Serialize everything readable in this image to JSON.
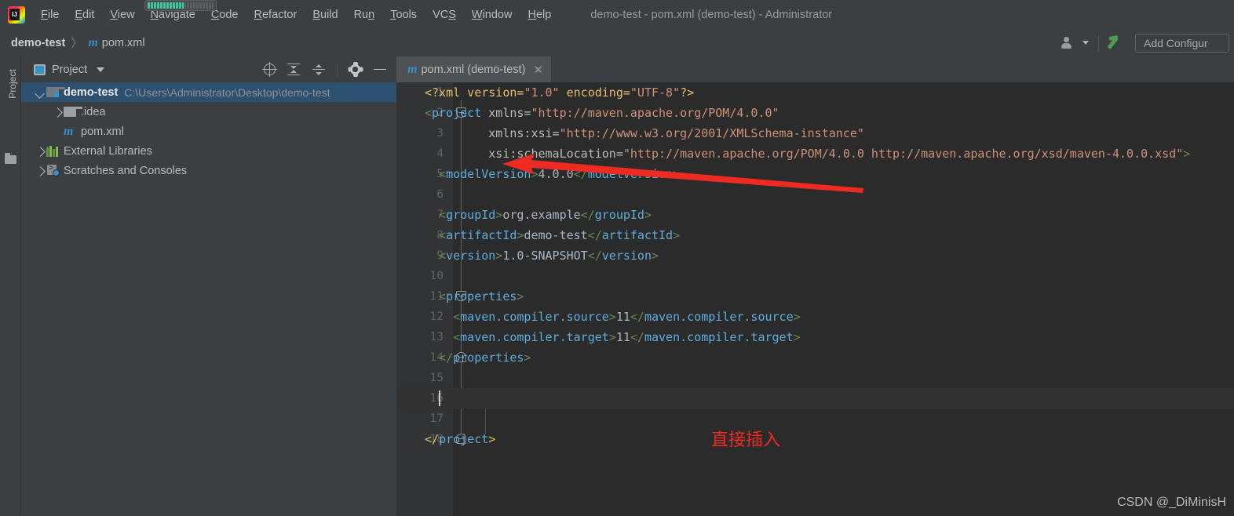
{
  "window": {
    "title": "demo-test - pom.xml (demo-test) - Administrator",
    "logo_icon": "intellij-idea-logo"
  },
  "menubar": {
    "items": [
      {
        "label": "File",
        "mnemonic": "F"
      },
      {
        "label": "Edit",
        "mnemonic": "E"
      },
      {
        "label": "View",
        "mnemonic": "V"
      },
      {
        "label": "Navigate",
        "mnemonic": "N"
      },
      {
        "label": "Code",
        "mnemonic": "C"
      },
      {
        "label": "Refactor",
        "mnemonic": "R"
      },
      {
        "label": "Build",
        "mnemonic": "B"
      },
      {
        "label": "Run",
        "mnemonic": "n"
      },
      {
        "label": "Tools",
        "mnemonic": "T"
      },
      {
        "label": "VCS",
        "mnemonic": "S"
      },
      {
        "label": "Window",
        "mnemonic": "W"
      },
      {
        "label": "Help",
        "mnemonic": "H"
      }
    ]
  },
  "navbar": {
    "breadcrumb_project": "demo-test",
    "breadcrumb_sep": "〉",
    "breadcrumb_file": "pom.xml",
    "maven_icon": "m",
    "user_icon": "user-account-icon",
    "build_icon": "build-hammer-icon",
    "add_configuration": "Add Configur"
  },
  "left_strip": {
    "project_tool_label": "Project",
    "folder_icon": "folder-icon"
  },
  "project_panel": {
    "title": "Project",
    "toolbar_icons": [
      {
        "name": "select-opened-file-icon"
      },
      {
        "name": "expand-all-icon"
      },
      {
        "name": "collapse-all-icon"
      },
      {
        "name": "settings-gear-icon"
      },
      {
        "name": "hide-panel-icon"
      }
    ],
    "tree": [
      {
        "label": "demo-test",
        "path": "C:\\Users\\Administrator\\Desktop\\demo-test",
        "icon": "project-module-icon",
        "arrow": "down",
        "indent": 0,
        "selected": true,
        "bold": true
      },
      {
        "label": ".idea",
        "path": "",
        "icon": "folder-icon",
        "arrow": "right",
        "indent": 1,
        "selected": false,
        "bold": false
      },
      {
        "label": "pom.xml",
        "path": "",
        "icon": "maven-file-icon",
        "arrow": "none",
        "indent": 1,
        "selected": false,
        "bold": false
      },
      {
        "label": "External Libraries",
        "path": "",
        "icon": "libraries-icon",
        "arrow": "right",
        "indent": 0,
        "selected": false,
        "bold": false
      },
      {
        "label": "Scratches and Consoles",
        "path": "",
        "icon": "scratches-icon",
        "arrow": "right",
        "indent": 0,
        "selected": false,
        "bold": false
      }
    ]
  },
  "editor": {
    "tab_label": "pom.xml (demo-test)",
    "tab_icon": "maven-file-icon",
    "tab_close_icon": "close-icon",
    "cursor_line": 16,
    "line_numbers": [
      1,
      2,
      3,
      4,
      5,
      6,
      7,
      8,
      9,
      10,
      11,
      12,
      13,
      14,
      15,
      16,
      17,
      18
    ],
    "code_lines": [
      {
        "n": 1,
        "tokens": [
          {
            "t": "<?xml version=",
            "c": "s-proc"
          },
          {
            "t": "\"1.0\"",
            "c": "s-val"
          },
          {
            "t": " encoding=",
            "c": "s-proc"
          },
          {
            "t": "\"UTF-8\"",
            "c": "s-val"
          },
          {
            "t": "?>",
            "c": "s-proc"
          }
        ],
        "indent": 0
      },
      {
        "n": 2,
        "tokens": [
          {
            "t": "<",
            "c": "s-brk"
          },
          {
            "t": "project",
            "c": "s-name"
          },
          {
            "t": " xmlns=",
            "c": "s-attr"
          },
          {
            "t": "\"http://maven.apache.org/POM/4.0.0\"",
            "c": "s-val"
          }
        ],
        "indent": 0
      },
      {
        "n": 3,
        "tokens": [
          {
            "t": "xmlns:xsi=",
            "c": "s-attr"
          },
          {
            "t": "\"http://www.w3.org/2001/XMLSchema-instance\"",
            "c": "s-val"
          }
        ],
        "indent": 9
      },
      {
        "n": 4,
        "tokens": [
          {
            "t": "xsi:schemaLocation=",
            "c": "s-attr"
          },
          {
            "t": "\"http://maven.apache.org/POM/4.0.0 http://maven.apache.org/xsd/maven-4.0.0.xsd\"",
            "c": "s-val"
          },
          {
            "t": ">",
            "c": "s-brk"
          }
        ],
        "indent": 9
      },
      {
        "n": 5,
        "tokens": [
          {
            "t": "<",
            "c": "s-brk"
          },
          {
            "t": "modelVersion",
            "c": "s-name"
          },
          {
            "t": ">",
            "c": "s-brk"
          },
          {
            "t": "4.0.0",
            "c": "s-text"
          },
          {
            "t": "</",
            "c": "s-brk"
          },
          {
            "t": "modelVersion",
            "c": "s-name"
          },
          {
            "t": ">",
            "c": "s-brk"
          }
        ],
        "indent": 2
      },
      {
        "n": 6,
        "tokens": [],
        "indent": 0
      },
      {
        "n": 7,
        "tokens": [
          {
            "t": "<",
            "c": "s-brk"
          },
          {
            "t": "groupId",
            "c": "s-name"
          },
          {
            "t": ">",
            "c": "s-brk"
          },
          {
            "t": "org.example",
            "c": "s-text"
          },
          {
            "t": "</",
            "c": "s-brk"
          },
          {
            "t": "groupId",
            "c": "s-name"
          },
          {
            "t": ">",
            "c": "s-brk"
          }
        ],
        "indent": 2
      },
      {
        "n": 8,
        "tokens": [
          {
            "t": "<",
            "c": "s-brk"
          },
          {
            "t": "artifactId",
            "c": "s-name"
          },
          {
            "t": ">",
            "c": "s-brk"
          },
          {
            "t": "demo-test",
            "c": "s-text"
          },
          {
            "t": "</",
            "c": "s-brk"
          },
          {
            "t": "artifactId",
            "c": "s-name"
          },
          {
            "t": ">",
            "c": "s-brk"
          }
        ],
        "indent": 2
      },
      {
        "n": 9,
        "tokens": [
          {
            "t": "<",
            "c": "s-brk"
          },
          {
            "t": "version",
            "c": "s-name"
          },
          {
            "t": ">",
            "c": "s-brk"
          },
          {
            "t": "1.0-SNAPSHOT",
            "c": "s-text"
          },
          {
            "t": "</",
            "c": "s-brk"
          },
          {
            "t": "version",
            "c": "s-name"
          },
          {
            "t": ">",
            "c": "s-brk"
          }
        ],
        "indent": 2
      },
      {
        "n": 10,
        "tokens": [],
        "indent": 0
      },
      {
        "n": 11,
        "tokens": [
          {
            "t": "<",
            "c": "s-brk"
          },
          {
            "t": "properties",
            "c": "s-name"
          },
          {
            "t": ">",
            "c": "s-brk"
          }
        ],
        "indent": 2
      },
      {
        "n": 12,
        "tokens": [
          {
            "t": "<",
            "c": "s-brk"
          },
          {
            "t": "maven.compiler.source",
            "c": "s-name"
          },
          {
            "t": ">",
            "c": "s-brk"
          },
          {
            "t": "11",
            "c": "s-text"
          },
          {
            "t": "</",
            "c": "s-brk"
          },
          {
            "t": "maven.compiler.source",
            "c": "s-name"
          },
          {
            "t": ">",
            "c": "s-brk"
          }
        ],
        "indent": 4
      },
      {
        "n": 13,
        "tokens": [
          {
            "t": "<",
            "c": "s-brk"
          },
          {
            "t": "maven.compiler.target",
            "c": "s-name"
          },
          {
            "t": ">",
            "c": "s-brk"
          },
          {
            "t": "11",
            "c": "s-text"
          },
          {
            "t": "</",
            "c": "s-brk"
          },
          {
            "t": "maven.compiler.target",
            "c": "s-name"
          },
          {
            "t": ">",
            "c": "s-brk"
          }
        ],
        "indent": 4
      },
      {
        "n": 14,
        "tokens": [
          {
            "t": "</",
            "c": "s-brk"
          },
          {
            "t": "properties",
            "c": "s-name"
          },
          {
            "t": ">",
            "c": "s-brk"
          }
        ],
        "indent": 2
      },
      {
        "n": 15,
        "tokens": [],
        "indent": 0
      },
      {
        "n": 16,
        "tokens": [],
        "indent": 2
      },
      {
        "n": 17,
        "tokens": [],
        "indent": 0
      },
      {
        "n": 18,
        "tokens": [
          {
            "t": "</",
            "c": "s-tag"
          },
          {
            "t": "project",
            "c": "s-name"
          },
          {
            "t": ">",
            "c": "s-tag"
          }
        ],
        "indent": 0
      }
    ],
    "fold_markers": [
      {
        "line": 2,
        "type": "open"
      },
      {
        "line": 11,
        "type": "open"
      },
      {
        "line": 14,
        "type": "close"
      },
      {
        "line": 18,
        "type": "close"
      }
    ]
  },
  "annotation": {
    "text": "直接插入",
    "color": "#ee2b22",
    "arrow_name": "red-pointer-arrow"
  },
  "watermark": "CSDN @_DiMinisH",
  "colors": {
    "accent": "#3592c4",
    "panel_bg": "#3c3f41",
    "editor_bg": "#2b2b2b",
    "gutter_bg": "#313335",
    "selection_bg": "#2d4f70",
    "annotation_red": "#ee2b22"
  }
}
